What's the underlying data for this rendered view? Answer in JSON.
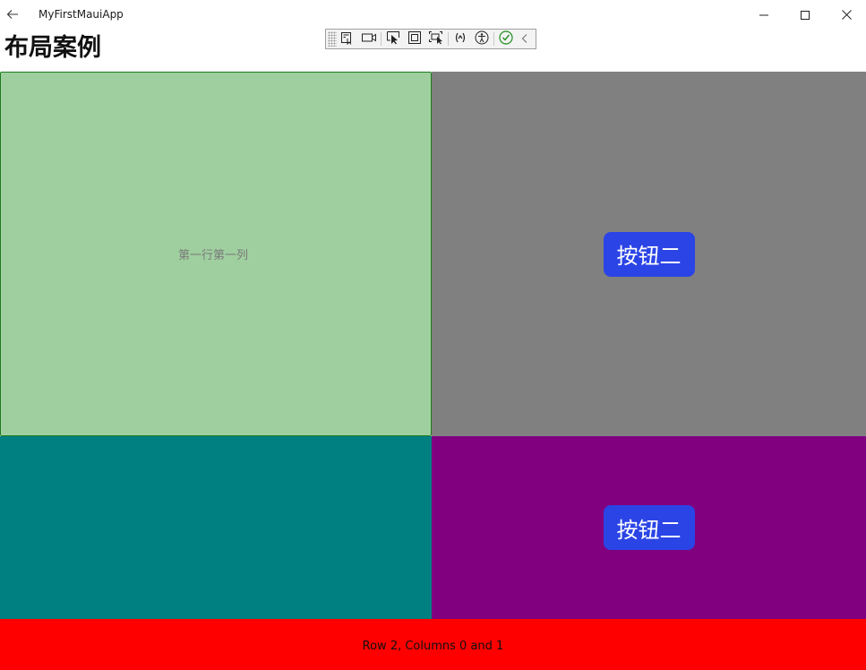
{
  "window": {
    "title": "MyFirstMauiApp",
    "back_icon": "back-arrow-icon",
    "controls": [
      "minimize-icon",
      "maximize-icon",
      "close-icon"
    ]
  },
  "page": {
    "title": "布局案例"
  },
  "debug_toolbar": {
    "items": [
      "live-visual-tree-icon",
      "record-icon",
      "select-element-icon",
      "display-layout-adorners-icon",
      "track-focus-icon",
      "binding-failures-icon",
      "accessibility-icon",
      "check-ok-icon",
      "collapse-chevron-icon"
    ]
  },
  "grid": {
    "row0_col0": {
      "label": "第一行第一列",
      "background": "#9fcf9f"
    },
    "row0_col1": {
      "button_label": "按钮二",
      "background": "#808080"
    },
    "row1_col0": {
      "background": "#008080"
    },
    "row1_col1": {
      "button_label": "按钮二",
      "background": "#800080"
    },
    "row2": {
      "label": "Row 2, Columns 0 and 1",
      "background": "#ff0000"
    }
  },
  "colors": {
    "button": "#2b44e6",
    "button_text": "#ffffff"
  }
}
